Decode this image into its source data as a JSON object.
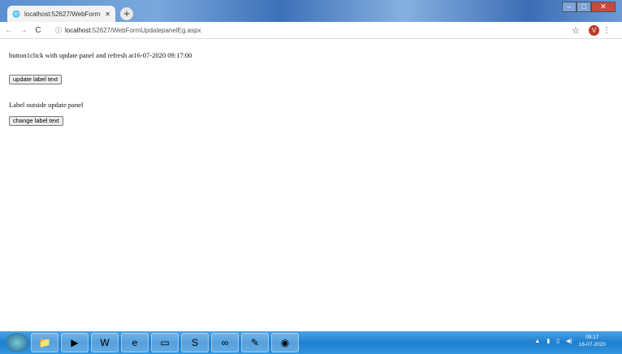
{
  "browser": {
    "tab_title": "localhost:52627/WebFormUpdat",
    "tab_close": "✕",
    "new_tab": "+",
    "url_host": "localhost",
    "url_rest": ":52627/WebFormUpdatepanelEg.aspx",
    "profile_initial": "V",
    "window_controls": {
      "minimize": "–",
      "maximize": "□",
      "close": "✕"
    }
  },
  "page": {
    "update_panel_label": "button1click with update panel and refresh at16-07-2020 09:17:00",
    "update_button": "update label text",
    "outside_label": "Label outside update panel",
    "change_button": "change label text"
  },
  "taskbar": {
    "apps": [
      "file-explorer",
      "media-player",
      "word",
      "internet-explorer",
      "notepad",
      "skype",
      "app",
      "paint",
      "chrome"
    ],
    "time": "09:17",
    "date": "16-07-2020"
  }
}
